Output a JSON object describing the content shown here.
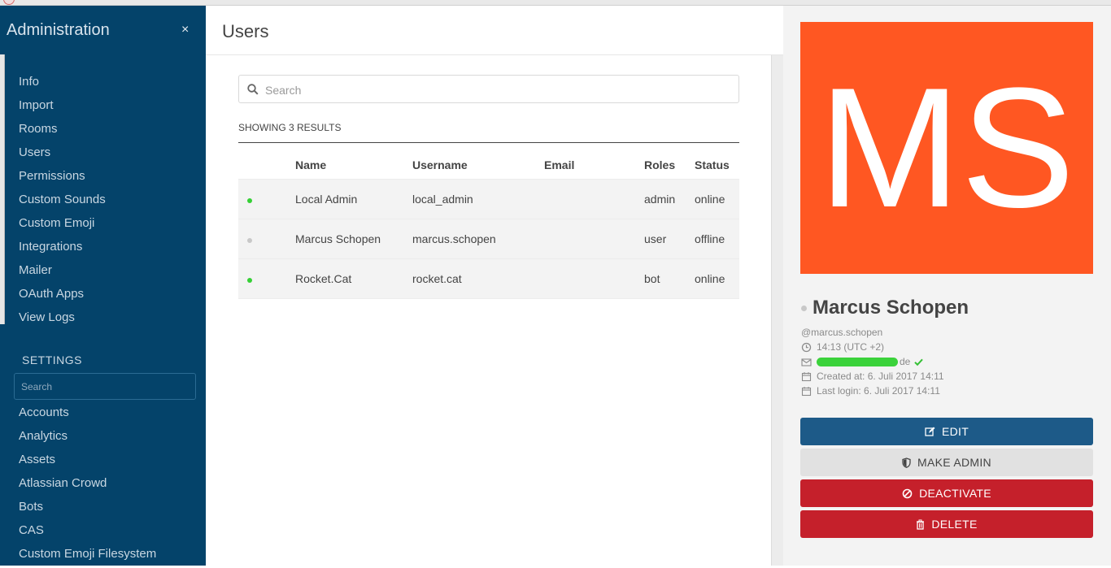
{
  "sidebar": {
    "title": "Administration",
    "close_label": "×",
    "items": [
      "Info",
      "Import",
      "Rooms",
      "Users",
      "Permissions",
      "Custom Sounds",
      "Custom Emoji",
      "Integrations",
      "Mailer",
      "OAuth Apps",
      "View Logs"
    ],
    "settings_heading": "SETTINGS",
    "settings_search_placeholder": "Search",
    "settings_items": [
      "Accounts",
      "Analytics",
      "Assets",
      "Atlassian Crowd",
      "Bots",
      "CAS",
      "Custom Emoji Filesystem"
    ]
  },
  "main": {
    "title": "Users",
    "search_placeholder": "Search",
    "results_label": "SHOWING 3 RESULTS",
    "columns": [
      "",
      "Name",
      "Username",
      "Email",
      "Roles",
      "Status"
    ],
    "rows": [
      {
        "status_color": "#35d035",
        "name": "Local Admin",
        "username": "local_admin",
        "email": "",
        "roles": "admin",
        "status": "online"
      },
      {
        "status_color": "#c8c8c8",
        "name": "Marcus Schopen",
        "username": "marcus.schopen",
        "email": "",
        "roles": "user",
        "status": "offline"
      },
      {
        "status_color": "#35d035",
        "name": "Rocket.Cat",
        "username": "rocket.cat",
        "email": "",
        "roles": "bot",
        "status": "online"
      }
    ]
  },
  "profile": {
    "initials": "MS",
    "avatar_color": "#ff5722",
    "name": "Marcus Schopen",
    "username": "@marcus.schopen",
    "time": "14:13 (UTC +2)",
    "email_suffix": "de",
    "created": "Created at: 6. Juli 2017 14:11",
    "last_login": "Last login: 6. Juli 2017 14:11",
    "buttons": {
      "edit": "EDIT",
      "make_admin": "MAKE ADMIN",
      "deactivate": "DEACTIVATE",
      "delete": "DELETE"
    }
  },
  "colors": {
    "sidebar_bg": "#04436a",
    "edit_button": "#1d5a88",
    "danger_button": "#c5202b",
    "online": "#35d035",
    "offline": "#c8c8c8"
  }
}
